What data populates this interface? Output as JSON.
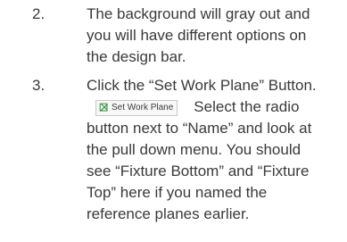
{
  "steps": [
    {
      "number": "2.",
      "lines": [
        "The background will gray out and",
        "you will have different options on",
        "the design bar."
      ]
    },
    {
      "number": "3.",
      "first_line": "Click the “Set Work Plane” Button.",
      "button": {
        "icon": "set-work-plane-icon",
        "label": "Set Work Plane"
      },
      "after_button": "Select the radio",
      "lines": [
        "button next to “Name” and look at",
        "the pull down menu. You should",
        "see “Fixture Bottom” and “Fixture",
        "Top” here if you named the",
        "reference planes earlier."
      ]
    }
  ]
}
